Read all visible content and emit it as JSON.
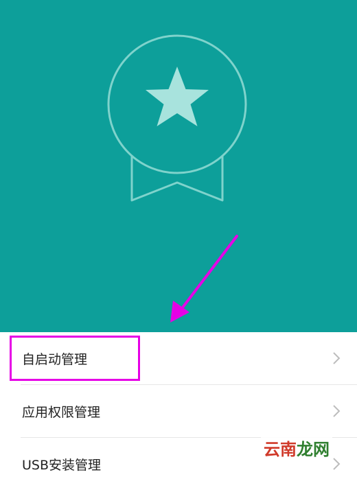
{
  "menu": {
    "items": [
      {
        "label": "自启动管理"
      },
      {
        "label": "应用权限管理"
      },
      {
        "label": "USB安装管理"
      }
    ]
  },
  "watermark": {
    "part1": "云南",
    "part2": "龙网"
  },
  "colors": {
    "hero_bg": "#0d9f9a",
    "highlight": "#e600e6",
    "star": "#a8e3dd"
  }
}
